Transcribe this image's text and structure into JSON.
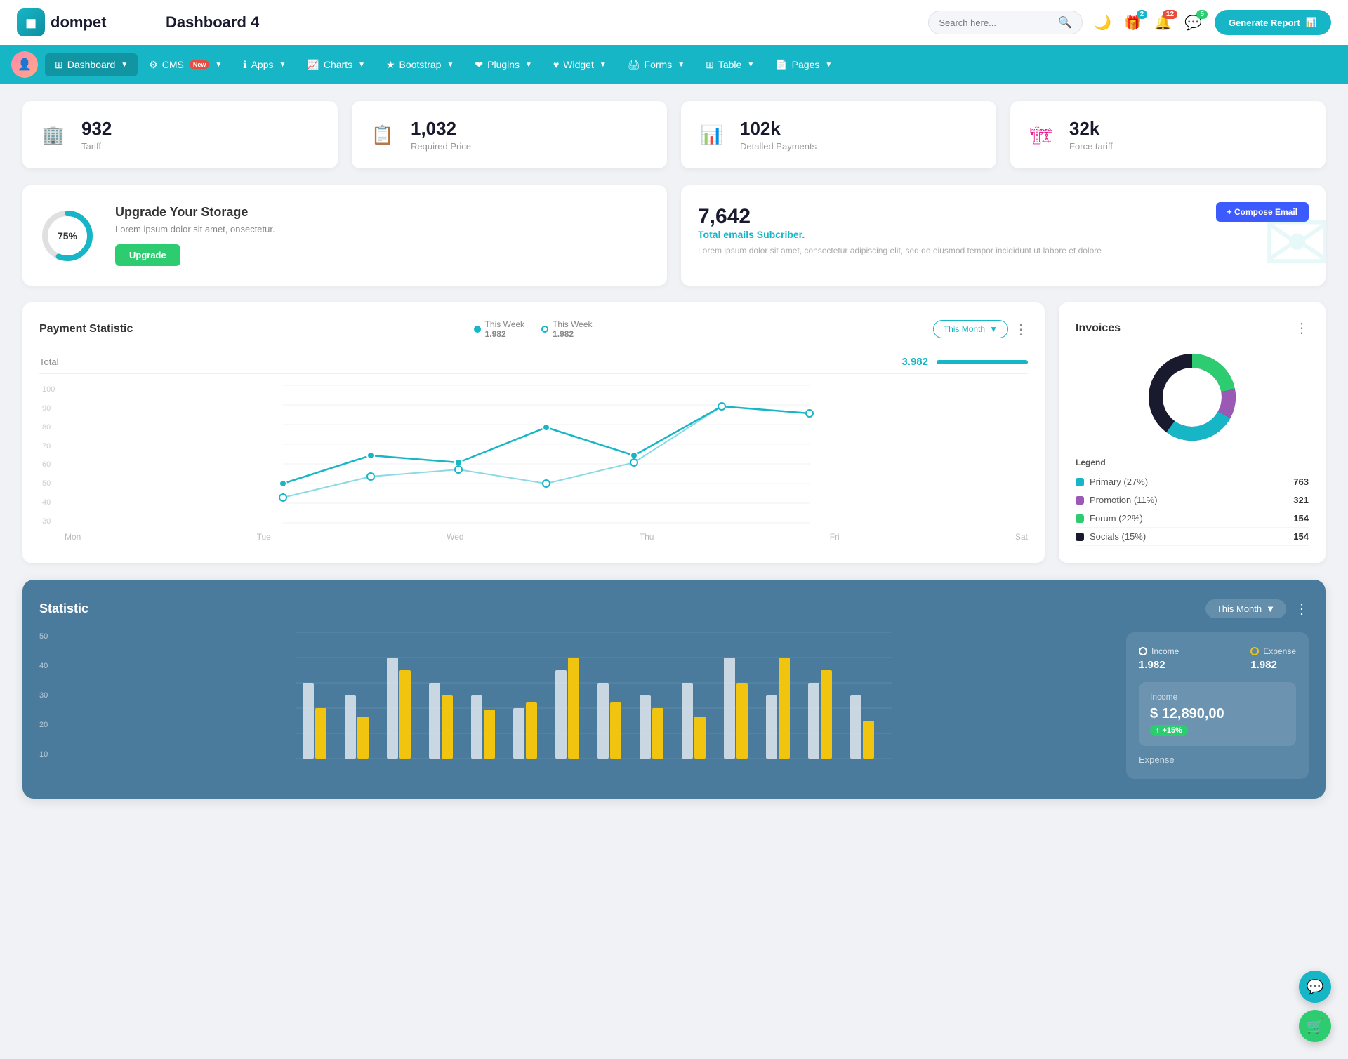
{
  "topbar": {
    "logo_text": "dompet",
    "page_title": "Dashboard 4",
    "search_placeholder": "Search here...",
    "icons": {
      "dark_mode": "🌙",
      "gift": "🎁",
      "bell": "🔔",
      "chat": "💬"
    },
    "badges": {
      "gift": "2",
      "bell": "12",
      "chat": "5"
    },
    "generate_btn": "Generate Report"
  },
  "navbar": {
    "items": [
      {
        "id": "dashboard",
        "label": "Dashboard",
        "active": true,
        "has_arrow": true
      },
      {
        "id": "cms",
        "label": "CMS",
        "active": false,
        "has_arrow": true,
        "badge": "New"
      },
      {
        "id": "apps",
        "label": "Apps",
        "active": false,
        "has_arrow": true
      },
      {
        "id": "charts",
        "label": "Charts",
        "active": false,
        "has_arrow": true
      },
      {
        "id": "bootstrap",
        "label": "Bootstrap",
        "active": false,
        "has_arrow": true
      },
      {
        "id": "plugins",
        "label": "Plugins",
        "active": false,
        "has_arrow": true
      },
      {
        "id": "widget",
        "label": "Widget",
        "active": false,
        "has_arrow": true
      },
      {
        "id": "forms",
        "label": "Forms",
        "active": false,
        "has_arrow": true
      },
      {
        "id": "table",
        "label": "Table",
        "active": false,
        "has_arrow": true
      },
      {
        "id": "pages",
        "label": "Pages",
        "active": false,
        "has_arrow": true
      }
    ]
  },
  "stat_cards": [
    {
      "id": "tariff",
      "num": "932",
      "label": "Tariff",
      "icon": "🏢",
      "icon_color": "#17b6c7"
    },
    {
      "id": "required_price",
      "num": "1,032",
      "label": "Required Price",
      "icon": "📋",
      "icon_color": "#e74c3c"
    },
    {
      "id": "detailed_payments",
      "num": "102k",
      "label": "Detalled Payments",
      "icon": "📊",
      "icon_color": "#9b59b6"
    },
    {
      "id": "force_tariff",
      "num": "32k",
      "label": "Force tariff",
      "icon": "🏗",
      "icon_color": "#e91e8c"
    }
  ],
  "storage": {
    "title": "Upgrade Your Storage",
    "desc": "Lorem ipsum dolor sit amet, onsectetur.",
    "percent": 75,
    "btn_label": "Upgrade"
  },
  "email": {
    "num": "7,642",
    "sub_title": "Total emails Subcriber.",
    "desc": "Lorem ipsum dolor sit amet, consectetur adipiscing elit, sed do eiusmod tempor incididunt ut labore et dolore",
    "btn_label": "+ Compose Email"
  },
  "payment_chart": {
    "title": "Payment Statistic",
    "legend1_label": "This Week",
    "legend1_val": "1.982",
    "legend2_label": "This Week",
    "legend2_val": "1.982",
    "filter_label": "This Month",
    "total_label": "Total",
    "total_val": "3.982",
    "x_labels": [
      "Mon",
      "Tue",
      "Wed",
      "Thu",
      "Fri",
      "Sat"
    ],
    "y_labels": [
      "100",
      "90",
      "80",
      "70",
      "60",
      "50",
      "40",
      "30"
    ],
    "line1_points": "60,160 130,100 220,110 310,60 400,100 490,110 580,30 670,40",
    "line2_points": "60,140 130,130 220,120 310,140 400,110 490,160 580,30 670,40"
  },
  "invoices": {
    "title": "Invoices",
    "legend": [
      {
        "label": "Primary (27%)",
        "color": "#17b6c7",
        "val": "763"
      },
      {
        "label": "Promotion (11%)",
        "color": "#9b59b6",
        "val": "321"
      },
      {
        "label": "Forum (22%)",
        "color": "#2ecc71",
        "val": "154"
      },
      {
        "label": "Socials (15%)",
        "color": "#1a1a2e",
        "val": "154"
      }
    ]
  },
  "statistic": {
    "title": "Statistic",
    "filter_label": "This Month",
    "income_legend_label": "Income",
    "income_legend_val": "1.982",
    "expense_legend_label": "Expense",
    "expense_legend_val": "1.982",
    "income_box_label": "Income",
    "income_box_val": "$ 12,890,00",
    "income_badge": "+15%",
    "expense_label": "Expense"
  },
  "floating_btns": {
    "chat": "💬",
    "cart": "🛒"
  }
}
